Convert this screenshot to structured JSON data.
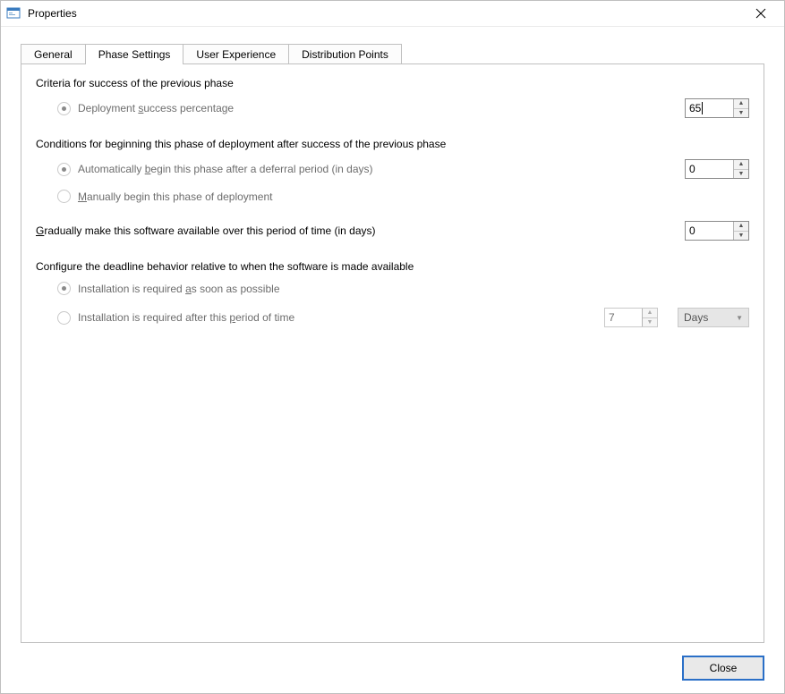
{
  "window": {
    "title": "Properties"
  },
  "tabs": {
    "general": "General",
    "phase_settings": "Phase Settings",
    "user_experience": "User Experience",
    "distribution_points": "Distribution Points"
  },
  "sections": {
    "criteria_heading": "Criteria for success of the previous phase",
    "deployment_success_prefix": "Deployment ",
    "deployment_success_u": "s",
    "deployment_success_suffix": "uccess percentage",
    "deployment_success_value": "65",
    "conditions_heading": "Conditions for beginning this phase of deployment after success of the previous phase",
    "auto_begin_prefix": "Automatically ",
    "auto_begin_u": "b",
    "auto_begin_suffix": "egin this phase after a deferral period (in days)",
    "auto_begin_value": "0",
    "manual_begin_u": "M",
    "manual_begin_suffix": "anually begin this phase of deployment",
    "gradual_u": "G",
    "gradual_suffix": "radually make this software available over this period of time (in days)",
    "gradual_value": "0",
    "deadline_heading": "Configure the deadline behavior relative to when the software is made available",
    "install_asap_prefix": "Installation is required ",
    "install_asap_u": "a",
    "install_asap_suffix": "s soon as possible",
    "install_after_prefix": "Installation is required after this ",
    "install_after_u": "p",
    "install_after_suffix": "eriod of time",
    "install_after_value": "7",
    "install_after_unit": "Days"
  },
  "footer": {
    "close": "Close"
  }
}
